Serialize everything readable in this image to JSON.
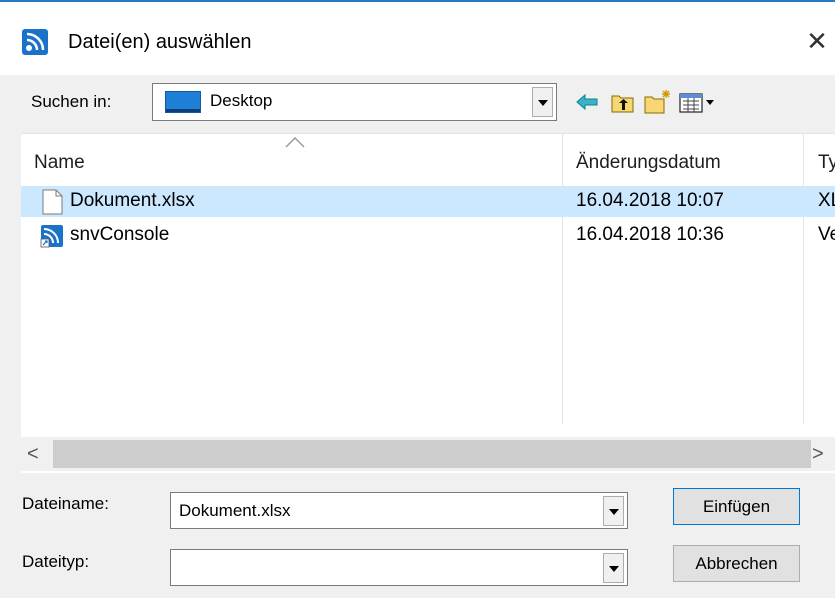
{
  "window": {
    "title": "Datei(en) auswählen",
    "close_glyph": "✕",
    "app_icon": "snvconsole-app-icon"
  },
  "lookin": {
    "label": "Suchen in:",
    "value": "Desktop",
    "icon": "desktop-icon"
  },
  "toolbar": {
    "back_icon": "back-arrow-icon",
    "up_icon": "up-folder-icon",
    "new_folder_icon": "new-folder-icon",
    "view_menu_icon": "view-menu-icon"
  },
  "list": {
    "columns": [
      "Name",
      "Änderungsdatum",
      "Ty"
    ],
    "rows": [
      {
        "name": "Dokument.xlsx",
        "date": "16.04.2018 10:07",
        "type": "XL",
        "icon": "document-file-icon",
        "selected": true
      },
      {
        "name": "snvConsole",
        "date": "16.04.2018 10:36",
        "type": "Ve",
        "icon": "snvconsole-shortcut-icon",
        "selected": false
      }
    ]
  },
  "hscroll": {
    "left": "<",
    "right": ">"
  },
  "filename": {
    "label": "Dateiname:",
    "value": "Dokument.xlsx"
  },
  "filetype": {
    "label": "Dateityp:",
    "value": ""
  },
  "buttons": {
    "insert": "Einfügen",
    "cancel": "Abbrechen"
  },
  "colors": {
    "accent": "#0078d7",
    "selection": "#cce8ff",
    "dialog_bg": "#f0f0f0"
  }
}
